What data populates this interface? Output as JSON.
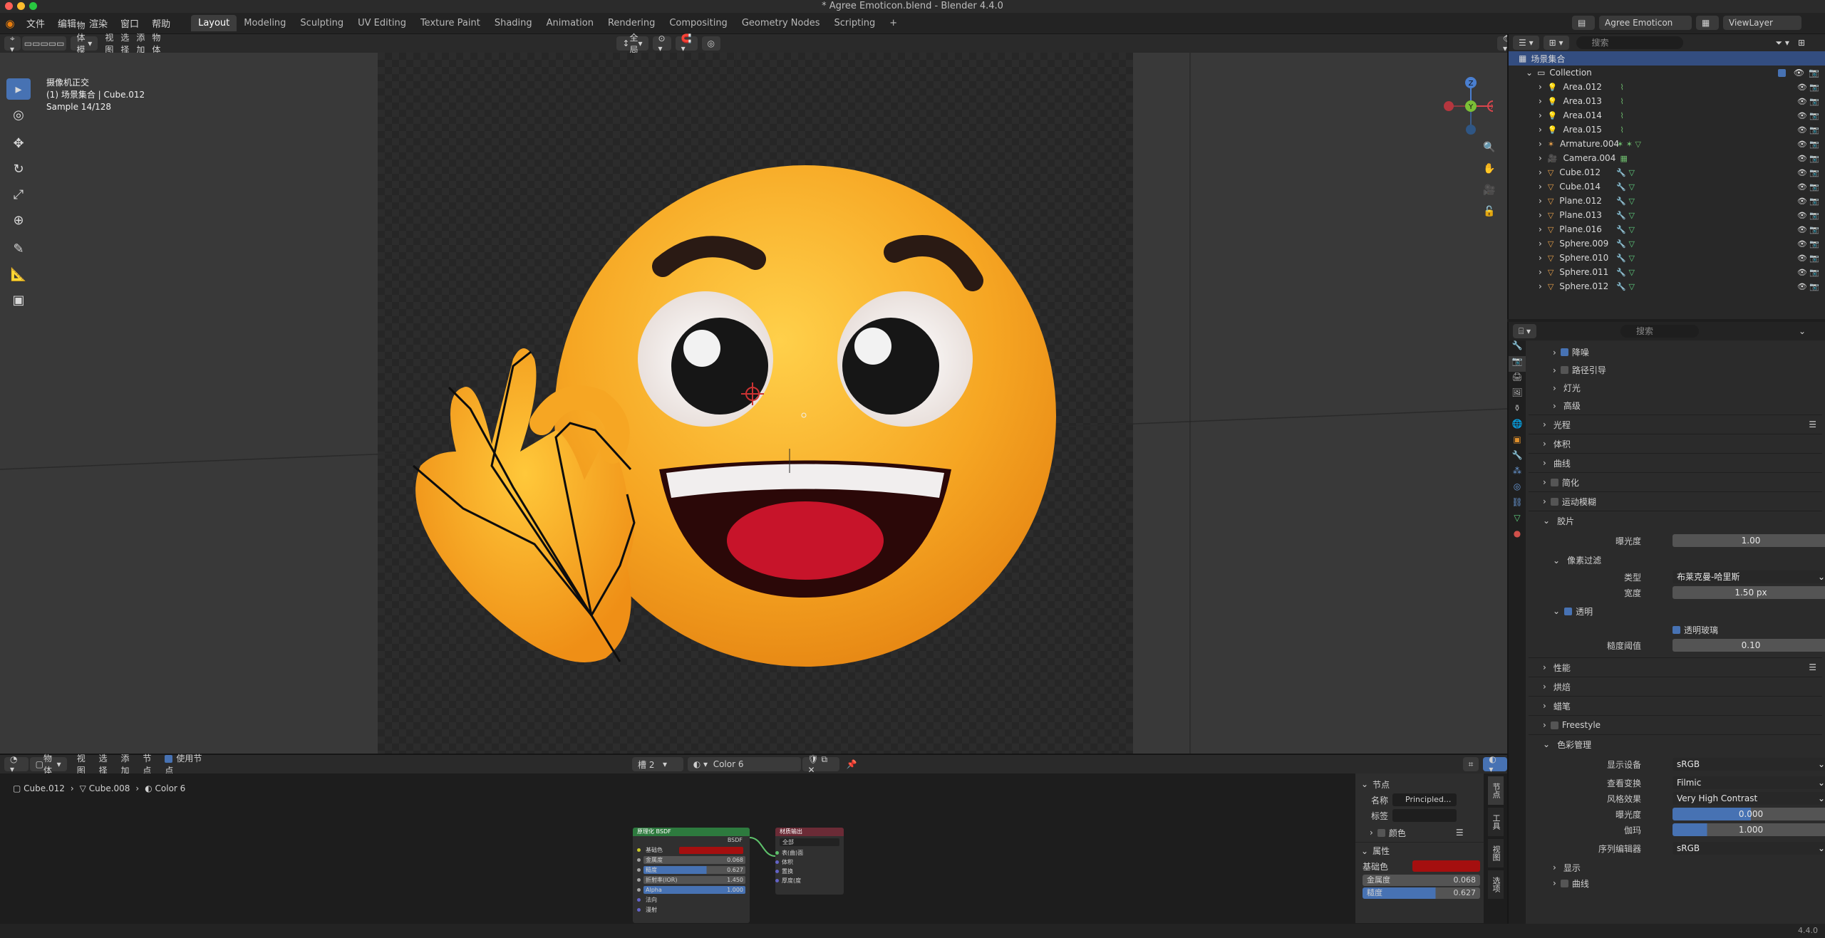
{
  "window": {
    "title": "* Agree Emoticon.blend - Blender 4.4.0"
  },
  "topbar": {
    "menus": [
      "文件",
      "编辑",
      "渲染",
      "窗口",
      "帮助"
    ],
    "workspaces": [
      "Layout",
      "Modeling",
      "Sculpting",
      "UV Editing",
      "Texture Paint",
      "Shading",
      "Animation",
      "Rendering",
      "Compositing",
      "Geometry Nodes",
      "Scripting"
    ],
    "add_tab": "+",
    "scene": "Agree Emoticon",
    "view_layer": "ViewLayer"
  },
  "viewport_header": {
    "mode": "物体模式",
    "menus": [
      "视图",
      "选择",
      "添加",
      "物体"
    ],
    "transform": "全局",
    "options": "选项"
  },
  "overlay": {
    "line1": "摄像机正交",
    "line2": "(1) 场景集合 | Cube.012",
    "line3": "Sample 14/128"
  },
  "gizmo": {
    "z": "Z",
    "y": "Y",
    "x": "X"
  },
  "outliner": {
    "search_placeholder": "搜索",
    "root": "场景集合",
    "collection": "Collection",
    "items": [
      {
        "name": "Area.012",
        "type": "light"
      },
      {
        "name": "Area.013",
        "type": "light"
      },
      {
        "name": "Area.014",
        "type": "light"
      },
      {
        "name": "Area.015",
        "type": "light"
      },
      {
        "name": "Armature.004",
        "type": "armature"
      },
      {
        "name": "Camera.004",
        "type": "camera"
      },
      {
        "name": "Cube.012",
        "type": "mesh"
      },
      {
        "name": "Cube.014",
        "type": "mesh"
      },
      {
        "name": "Plane.012",
        "type": "mesh"
      },
      {
        "name": "Plane.013",
        "type": "mesh"
      },
      {
        "name": "Plane.016",
        "type": "mesh"
      },
      {
        "name": "Sphere.009",
        "type": "mesh"
      },
      {
        "name": "Sphere.010",
        "type": "mesh"
      },
      {
        "name": "Sphere.011",
        "type": "mesh"
      },
      {
        "name": "Sphere.012",
        "type": "mesh"
      }
    ]
  },
  "properties": {
    "search_placeholder": "搜索",
    "sub_denoise": "降噪",
    "sub_path_guiding": "路径引导",
    "sub_lights": "灯光",
    "sub_advanced": "高级",
    "sec_light_paths": "光程",
    "sec_volumes": "体积",
    "sec_curves": "曲线",
    "sec_simplify": "简化",
    "sec_motion_blur": "运动模糊",
    "sec_film": "胶片",
    "exposure_label": "曝光度",
    "exposure_value": "1.00",
    "pixel_filter": "像素过滤",
    "filter_type_label": "类型",
    "filter_type_value": "布莱克曼-哈里斯",
    "filter_width_label": "宽度",
    "filter_width_value": "1.50 px",
    "transparent": "透明",
    "transparent_glass": "透明玻璃",
    "roughness_threshold_label": "糙度阈值",
    "roughness_threshold_value": "0.10",
    "sec_performance": "性能",
    "sec_bake": "烘焙",
    "sec_grease_pencil": "蜡笔",
    "sec_freestyle": "Freestyle",
    "sec_color_management": "色彩管理",
    "display_device_label": "显示设备",
    "display_device_value": "sRGB",
    "view_transform_label": "查看变换",
    "view_transform_value": "Filmic",
    "look_label": "风格效果",
    "look_value": "Very High Contrast",
    "cm_exposure_label": "曝光度",
    "cm_exposure_value": "0.000",
    "gamma_label": "伽玛",
    "gamma_value": "1.000",
    "sequencer_label": "序列编辑器",
    "sequencer_value": "sRGB",
    "sub_display": "显示",
    "sub_curves": "曲线"
  },
  "node_editor": {
    "object": "物体",
    "menus": [
      "视图",
      "选择",
      "添加",
      "节点"
    ],
    "use_nodes": "使用节点",
    "slot": "槽 2",
    "material": "Color 6",
    "breadcrumb": [
      "Cube.012",
      "Cube.008",
      "Color 6"
    ],
    "bsdf_node": {
      "title": "原理化 BSDF",
      "output": "BSDF",
      "inputs": [
        {
          "label": "基础色",
          "value": ""
        },
        {
          "label": "金属度",
          "value": "0.068"
        },
        {
          "label": "糙度",
          "value": "0.627"
        },
        {
          "label": "折射率(IOR)",
          "value": "1.450"
        },
        {
          "label": "Alpha",
          "value": "1.000"
        },
        {
          "label": "法向",
          "value": ""
        },
        {
          "label": "漫射",
          "value": ""
        }
      ]
    },
    "output_node": {
      "title": "材质输出",
      "target": "全部",
      "inputs": [
        "表(曲)面",
        "体积",
        "置换",
        "厚度(度"
      ]
    },
    "sidebar": {
      "section_node": "节点",
      "name_label": "名称",
      "name_value": "Principled...",
      "label_label": "标签",
      "color_label": "颜色",
      "section_props": "属性",
      "base_color_label": "基础色",
      "metallic_label": "金属度",
      "metallic_value": "0.068",
      "roughness_label": "糙度",
      "roughness_value": "0.627",
      "tabs": [
        "节点",
        "工具",
        "视图",
        "选项"
      ]
    }
  },
  "statusbar": {
    "version": "4.4.0"
  },
  "colors": {
    "accent": "#4772b3",
    "base_color": "#a50f0f",
    "emoji": "#f6a623"
  }
}
